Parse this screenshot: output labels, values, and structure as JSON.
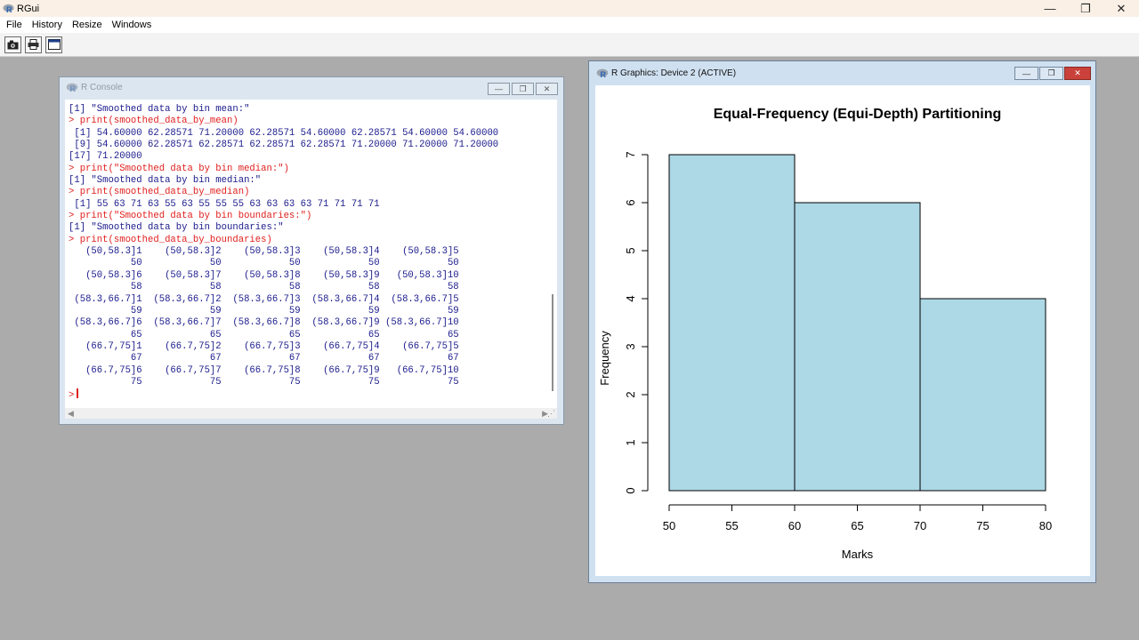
{
  "app": {
    "title": "RGui",
    "logo_letter": "R"
  },
  "window_controls": {
    "minimize": "—",
    "maximize": "❐",
    "close": "✕"
  },
  "menu": [
    {
      "label": "File"
    },
    {
      "label": "History"
    },
    {
      "label": "Resize"
    },
    {
      "label": "Windows"
    }
  ],
  "toolbar": [
    {
      "icon": "camera-icon"
    },
    {
      "icon": "printer-icon"
    },
    {
      "icon": "window-icon"
    }
  ],
  "console": {
    "title": "R Console",
    "prompt": ">",
    "lines": [
      {
        "kind": "out",
        "text": "[1] \"Smoothed data by bin mean:\""
      },
      {
        "kind": "cmd",
        "text": "> print(smoothed_data_by_mean)"
      },
      {
        "kind": "out",
        "text": " [1] 54.60000 62.28571 71.20000 62.28571 54.60000 62.28571 54.60000 54.60000"
      },
      {
        "kind": "out",
        "text": " [9] 54.60000 62.28571 62.28571 62.28571 62.28571 71.20000 71.20000 71.20000"
      },
      {
        "kind": "out",
        "text": "[17] 71.20000"
      },
      {
        "kind": "cmd",
        "text": "> print(\"Smoothed data by bin median:\")"
      },
      {
        "kind": "out",
        "text": "[1] \"Smoothed data by bin median:\""
      },
      {
        "kind": "cmd",
        "text": "> print(smoothed_data_by_median)"
      },
      {
        "kind": "out",
        "text": " [1] 55 63 71 63 55 63 55 55 55 63 63 63 63 71 71 71 71"
      },
      {
        "kind": "cmd",
        "text": "> print(\"Smoothed data by bin boundaries:\")"
      },
      {
        "kind": "out",
        "text": "[1] \"Smoothed data by bin boundaries:\""
      },
      {
        "kind": "cmd",
        "text": "> print(smoothed_data_by_boundaries)"
      },
      {
        "kind": "out",
        "text": "   (50,58.3]1    (50,58.3]2    (50,58.3]3    (50,58.3]4    (50,58.3]5"
      },
      {
        "kind": "out",
        "text": "           50            50            50            50            50"
      },
      {
        "kind": "out",
        "text": "   (50,58.3]6    (50,58.3]7    (50,58.3]8    (50,58.3]9   (50,58.3]10"
      },
      {
        "kind": "out",
        "text": "           58            58            58            58            58"
      },
      {
        "kind": "out",
        "text": " (58.3,66.7]1  (58.3,66.7]2  (58.3,66.7]3  (58.3,66.7]4  (58.3,66.7]5"
      },
      {
        "kind": "out",
        "text": "           59            59            59            59            59"
      },
      {
        "kind": "out",
        "text": " (58.3,66.7]6  (58.3,66.7]7  (58.3,66.7]8  (58.3,66.7]9 (58.3,66.7]10"
      },
      {
        "kind": "out",
        "text": "           65            65            65            65            65"
      },
      {
        "kind": "out",
        "text": "   (66.7,75]1    (66.7,75]2    (66.7,75]3    (66.7,75]4    (66.7,75]5"
      },
      {
        "kind": "out",
        "text": "           67            67            67            67            67"
      },
      {
        "kind": "out",
        "text": "   (66.7,75]6    (66.7,75]7    (66.7,75]8    (66.7,75]9   (66.7,75]10"
      },
      {
        "kind": "out",
        "text": "           75            75            75            75            75"
      }
    ]
  },
  "graphics": {
    "title": "R Graphics: Device 2 (ACTIVE)"
  },
  "chart_data": {
    "type": "bar",
    "title": "Equal-Frequency (Equi-Depth) Partitioning",
    "xlabel": "Marks",
    "ylabel": "Frequency",
    "bins": [
      {
        "from": 50,
        "to": 60,
        "count": 7
      },
      {
        "from": 60,
        "to": 70,
        "count": 6
      },
      {
        "from": 70,
        "to": 80,
        "count": 4
      }
    ],
    "x_ticks": [
      "50",
      "55",
      "60",
      "65",
      "70",
      "75",
      "80"
    ],
    "y_ticks": [
      "0",
      "1",
      "2",
      "3",
      "4",
      "5",
      "6",
      "7"
    ],
    "xlim": [
      50,
      80
    ],
    "ylim": [
      0,
      7
    ],
    "bar_color": "#add8e6",
    "grid": false,
    "legend": "none"
  }
}
